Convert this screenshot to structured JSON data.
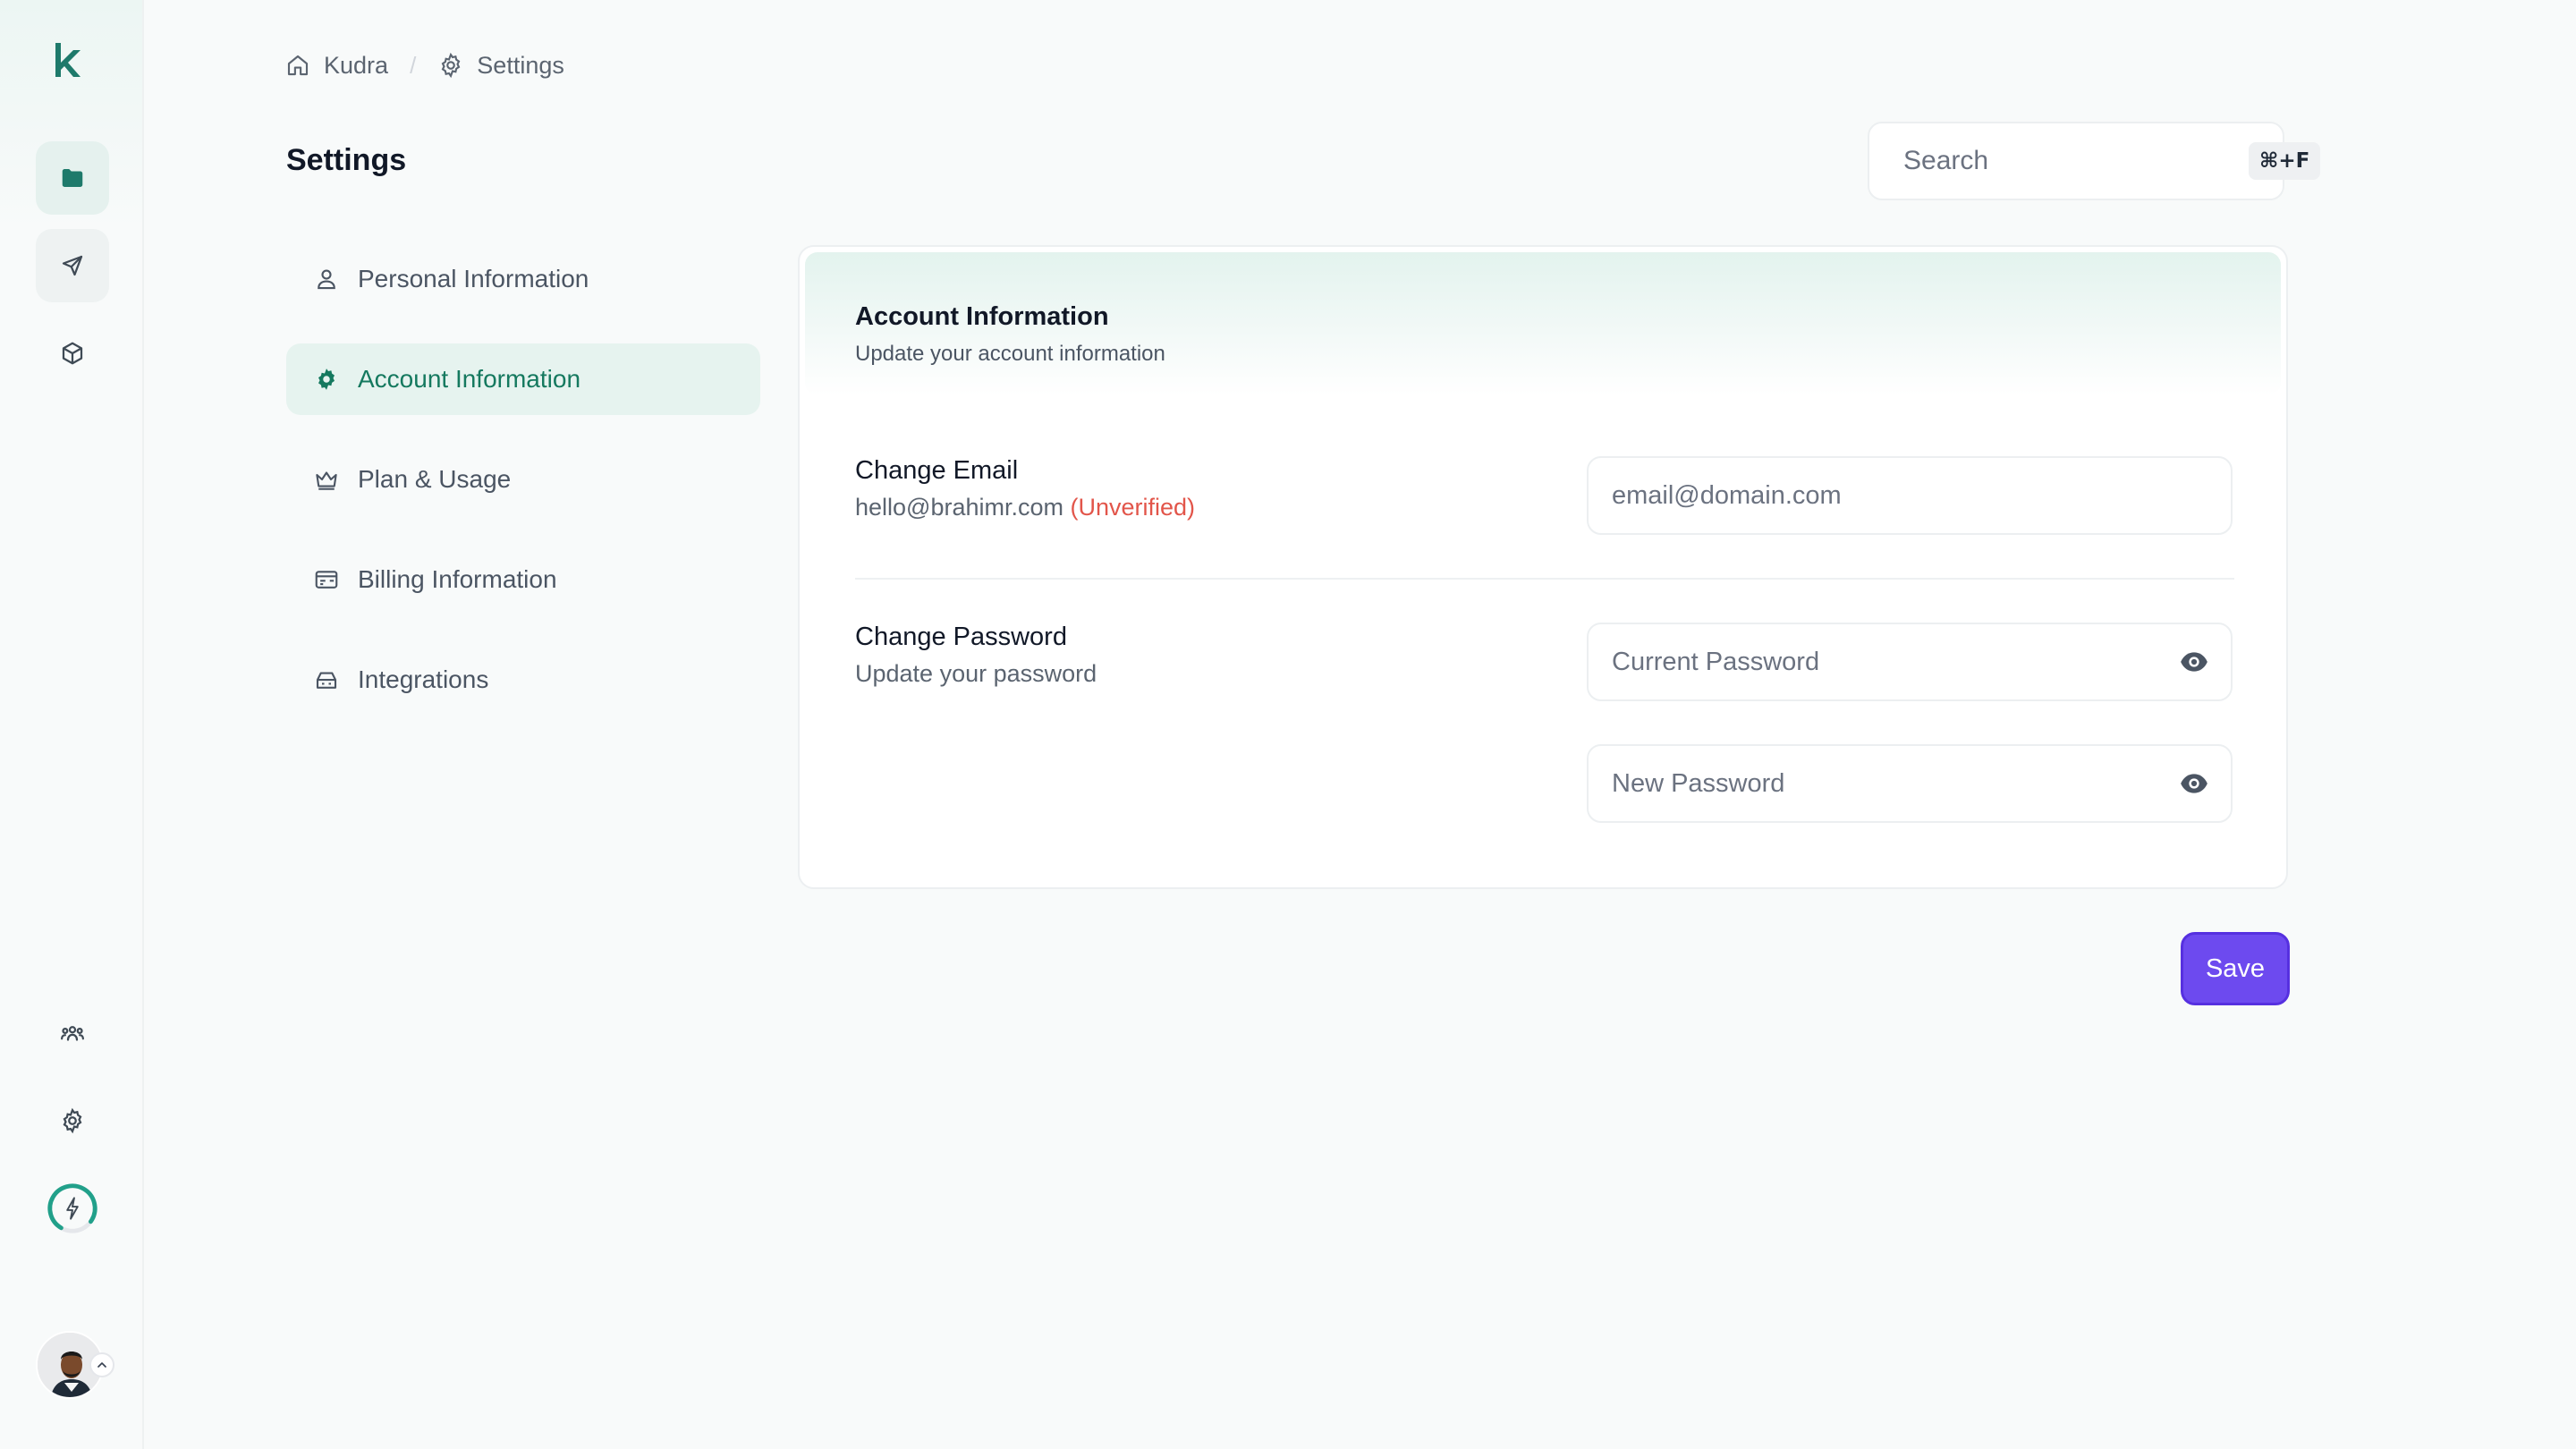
{
  "breadcrumb": {
    "home_label": "Kudra",
    "current_label": "Settings"
  },
  "page": {
    "title": "Settings"
  },
  "search": {
    "placeholder": "Search",
    "shortcut": "⌘+F"
  },
  "settings_nav": [
    {
      "label": "Personal Information",
      "icon": "user-icon",
      "active": false
    },
    {
      "label": "Account Information",
      "icon": "gear-icon",
      "active": true
    },
    {
      "label": "Plan & Usage",
      "icon": "crown-icon",
      "active": false
    },
    {
      "label": "Billing Information",
      "icon": "billing-card-icon",
      "active": false
    },
    {
      "label": "Integrations",
      "icon": "integrations-icon",
      "active": false
    }
  ],
  "card": {
    "title": "Account Information",
    "subtitle": "Update your account information",
    "email": {
      "label": "Change Email",
      "current_value": "hello@brahimr.com",
      "status": "(Unverified)",
      "placeholder": "email@domain.com",
      "value": ""
    },
    "password": {
      "label": "Change Password",
      "description": "Update your password",
      "current_placeholder": "Current Password",
      "new_placeholder": "New Password"
    }
  },
  "actions": {
    "save_label": "Save"
  },
  "colors": {
    "accent_green": "#15795f",
    "active_bg": "#e6f3ef",
    "primary_purple": "#6d4aef",
    "unverified_red": "#e2554a"
  }
}
